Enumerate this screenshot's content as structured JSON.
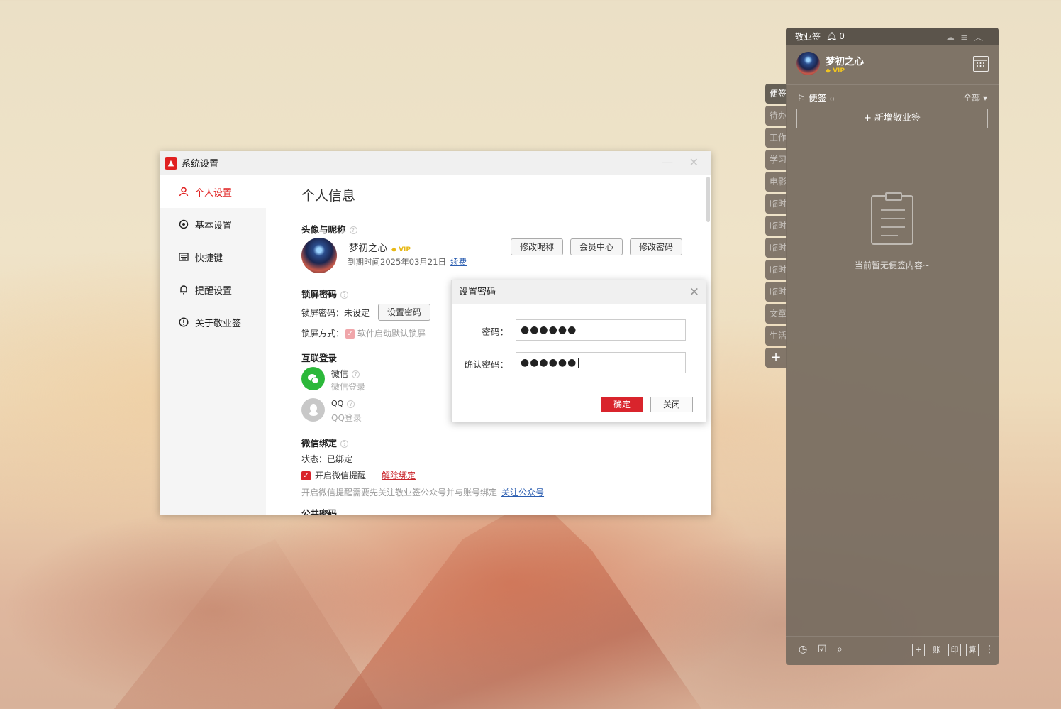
{
  "settings_window": {
    "title": "系统设置",
    "logo_glyph": "▲",
    "sidebar": [
      {
        "label": "个人设置",
        "icon": "user-icon",
        "active": true
      },
      {
        "label": "基本设置",
        "icon": "settings-icon",
        "active": false
      },
      {
        "label": "快捷键",
        "icon": "keyboard-icon",
        "active": false
      },
      {
        "label": "提醒设置",
        "icon": "bell-icon",
        "active": false
      },
      {
        "label": "关于敬业签",
        "icon": "info-icon",
        "active": false
      }
    ],
    "page_title": "个人信息",
    "avatar_section": {
      "title": "头像与昵称",
      "nickname": "梦初之心",
      "vip": "VIP",
      "expire": "到期时间2025年03月21日",
      "renew": "续费",
      "buttons": [
        "修改昵称",
        "会员中心",
        "修改密码"
      ]
    },
    "lock_section": {
      "title": "锁屏密码",
      "password_status": "锁屏密码：未设定",
      "set_button": "设置密码",
      "mode_label": "锁屏方式：",
      "mode_option": "软件启动默认锁屏"
    },
    "login_section": {
      "title": "互联登录",
      "wechat": {
        "name": "微信",
        "sub": "微信登录"
      },
      "qq": {
        "name": "QQ",
        "sub": "QQ登录"
      }
    },
    "wechat_bind": {
      "title": "微信绑定",
      "status": "状态：已绑定",
      "reminder": "开启微信提醒",
      "unbind": "解除绑定",
      "hint": "开启微信提醒需要先关注敬业签公众号并与账号绑定",
      "follow": "关注公众号"
    },
    "cut_off_section": "公共密码"
  },
  "password_dialog": {
    "title": "设置密码",
    "password_label": "密码：",
    "password_value": "●●●●●●",
    "confirm_label": "确认密码：",
    "confirm_value": "●●●●●●|",
    "ok": "确定",
    "close": "关闭"
  },
  "notes_panel": {
    "app_name": "敬业签",
    "bell_count": "0",
    "nickname": "梦初之心",
    "vip": "VIP",
    "category": "便签",
    "category_count": "0",
    "filter": "全部",
    "new_note": "+ 新增敬业签",
    "empty_text": "当前暂无便签内容~",
    "tabs": [
      "便签",
      "待办",
      "工作",
      "学习",
      "电影",
      "临时",
      "临时",
      "临时",
      "临时",
      "临时",
      "文章",
      "生活"
    ],
    "add_tab": "+",
    "bottom_tools": [
      "账",
      "印",
      "算"
    ]
  }
}
